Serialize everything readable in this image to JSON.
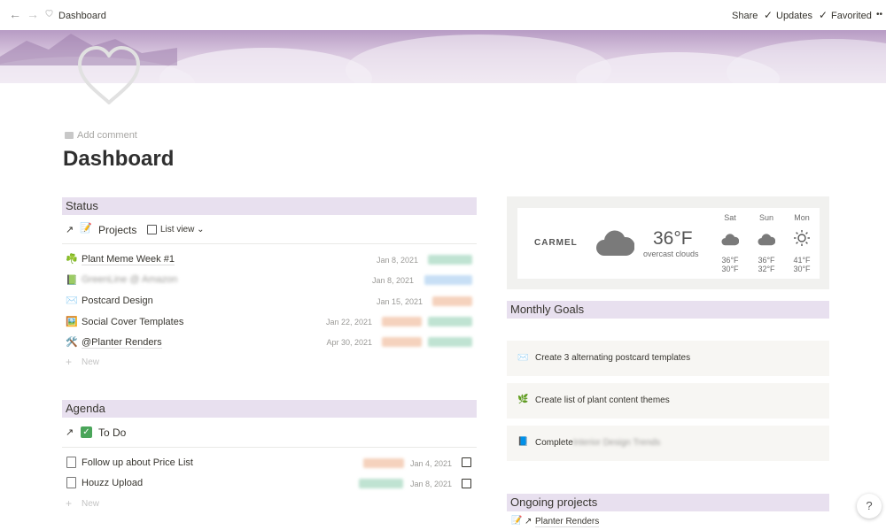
{
  "topbar": {
    "breadcrumb": "Dashboard",
    "share": "Share",
    "updates": "Updates",
    "favorited": "Favorited",
    "more": "••"
  },
  "page": {
    "add_comment": "Add comment",
    "title": "Dashboard"
  },
  "status": {
    "heading": "Status",
    "db_arrow": "↗",
    "db_icon": "📝",
    "db_title": "Projects",
    "view": "List view",
    "items": [
      {
        "icon": "☘️",
        "name": "Plant Meme Week #1",
        "date": "Jan 8, 2021",
        "tags": [
          "green"
        ]
      },
      {
        "icon": "📗",
        "name": "GreenLine @ Amazon",
        "date": "Jan 8, 2021",
        "tags": [
          "blue"
        ],
        "blurred": true
      },
      {
        "icon": "✉️",
        "name": "Postcard Design",
        "date": "Jan 15, 2021",
        "tags": [
          "orange"
        ]
      },
      {
        "icon": "🖼️",
        "name": "Social Cover Templates",
        "date": "Jan 22, 2021",
        "tags": [
          "orange",
          "green"
        ]
      },
      {
        "icon": "🛠️",
        "name": "@Planter Renders",
        "date": "Apr 30, 2021",
        "tags": [
          "orange",
          "green"
        ]
      }
    ],
    "new": "New"
  },
  "agenda": {
    "heading": "Agenda",
    "db_arrow": "↗",
    "db_icon": "✅",
    "db_title": "To Do",
    "items": [
      {
        "name": "Follow up about Price List",
        "date": "Jan 4, 2021",
        "tag": "orange"
      },
      {
        "name": "Houzz Upload",
        "date": "Jan 8, 2021",
        "tag": "green"
      }
    ],
    "new": "New"
  },
  "weather": {
    "city": "CARMEL",
    "temp": "36°F",
    "desc": "overcast clouds",
    "forecast": [
      {
        "day": "Sat",
        "icon": "cloud-icon",
        "high": "36°F",
        "low": "30°F"
      },
      {
        "day": "Sun",
        "icon": "cloud-icon",
        "high": "36°F",
        "low": "32°F"
      },
      {
        "day": "Mon",
        "icon": "sun-icon",
        "high": "41°F",
        "low": "30°F"
      }
    ]
  },
  "goals": {
    "heading": "Monthly Goals",
    "items": [
      {
        "icon": "✉️",
        "text": "Create 3 alternating postcard templates"
      },
      {
        "icon": "🌿",
        "text": "Create list of plant content themes"
      },
      {
        "icon": "📘",
        "text": "Complete",
        "blurred_suffix": "Interior Design Trends"
      }
    ]
  },
  "ongoing": {
    "heading": "Ongoing projects",
    "item_icon": "📝",
    "item_arrow": "↗",
    "item": "Planter Renders"
  },
  "help": "?"
}
